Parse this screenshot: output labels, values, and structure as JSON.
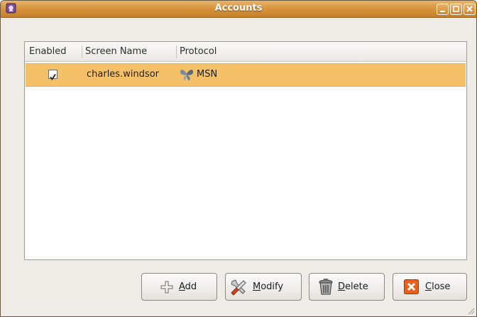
{
  "window": {
    "title": "Accounts"
  },
  "columns": [
    "Enabled",
    "Screen Name",
    "Protocol"
  ],
  "accounts": [
    {
      "enabled": true,
      "screen_name": "charles.windsor",
      "protocol": "MSN",
      "protocol_icon": "msn-butterfly-icon"
    }
  ],
  "buttons": {
    "add": {
      "mnemonic": "A",
      "rest": "dd",
      "icon": "plus-icon"
    },
    "modify": {
      "mnemonic": "M",
      "rest": "odify",
      "icon": "tools-icon"
    },
    "delete": {
      "mnemonic": "D",
      "rest": "elete",
      "icon": "trash-icon"
    },
    "close": {
      "mnemonic": "C",
      "rest": "lose",
      "icon": "close-x-icon"
    }
  },
  "colors": {
    "titlebar": "#d6923c",
    "selection": "#f5c168",
    "close_accent": "#e8601c"
  }
}
